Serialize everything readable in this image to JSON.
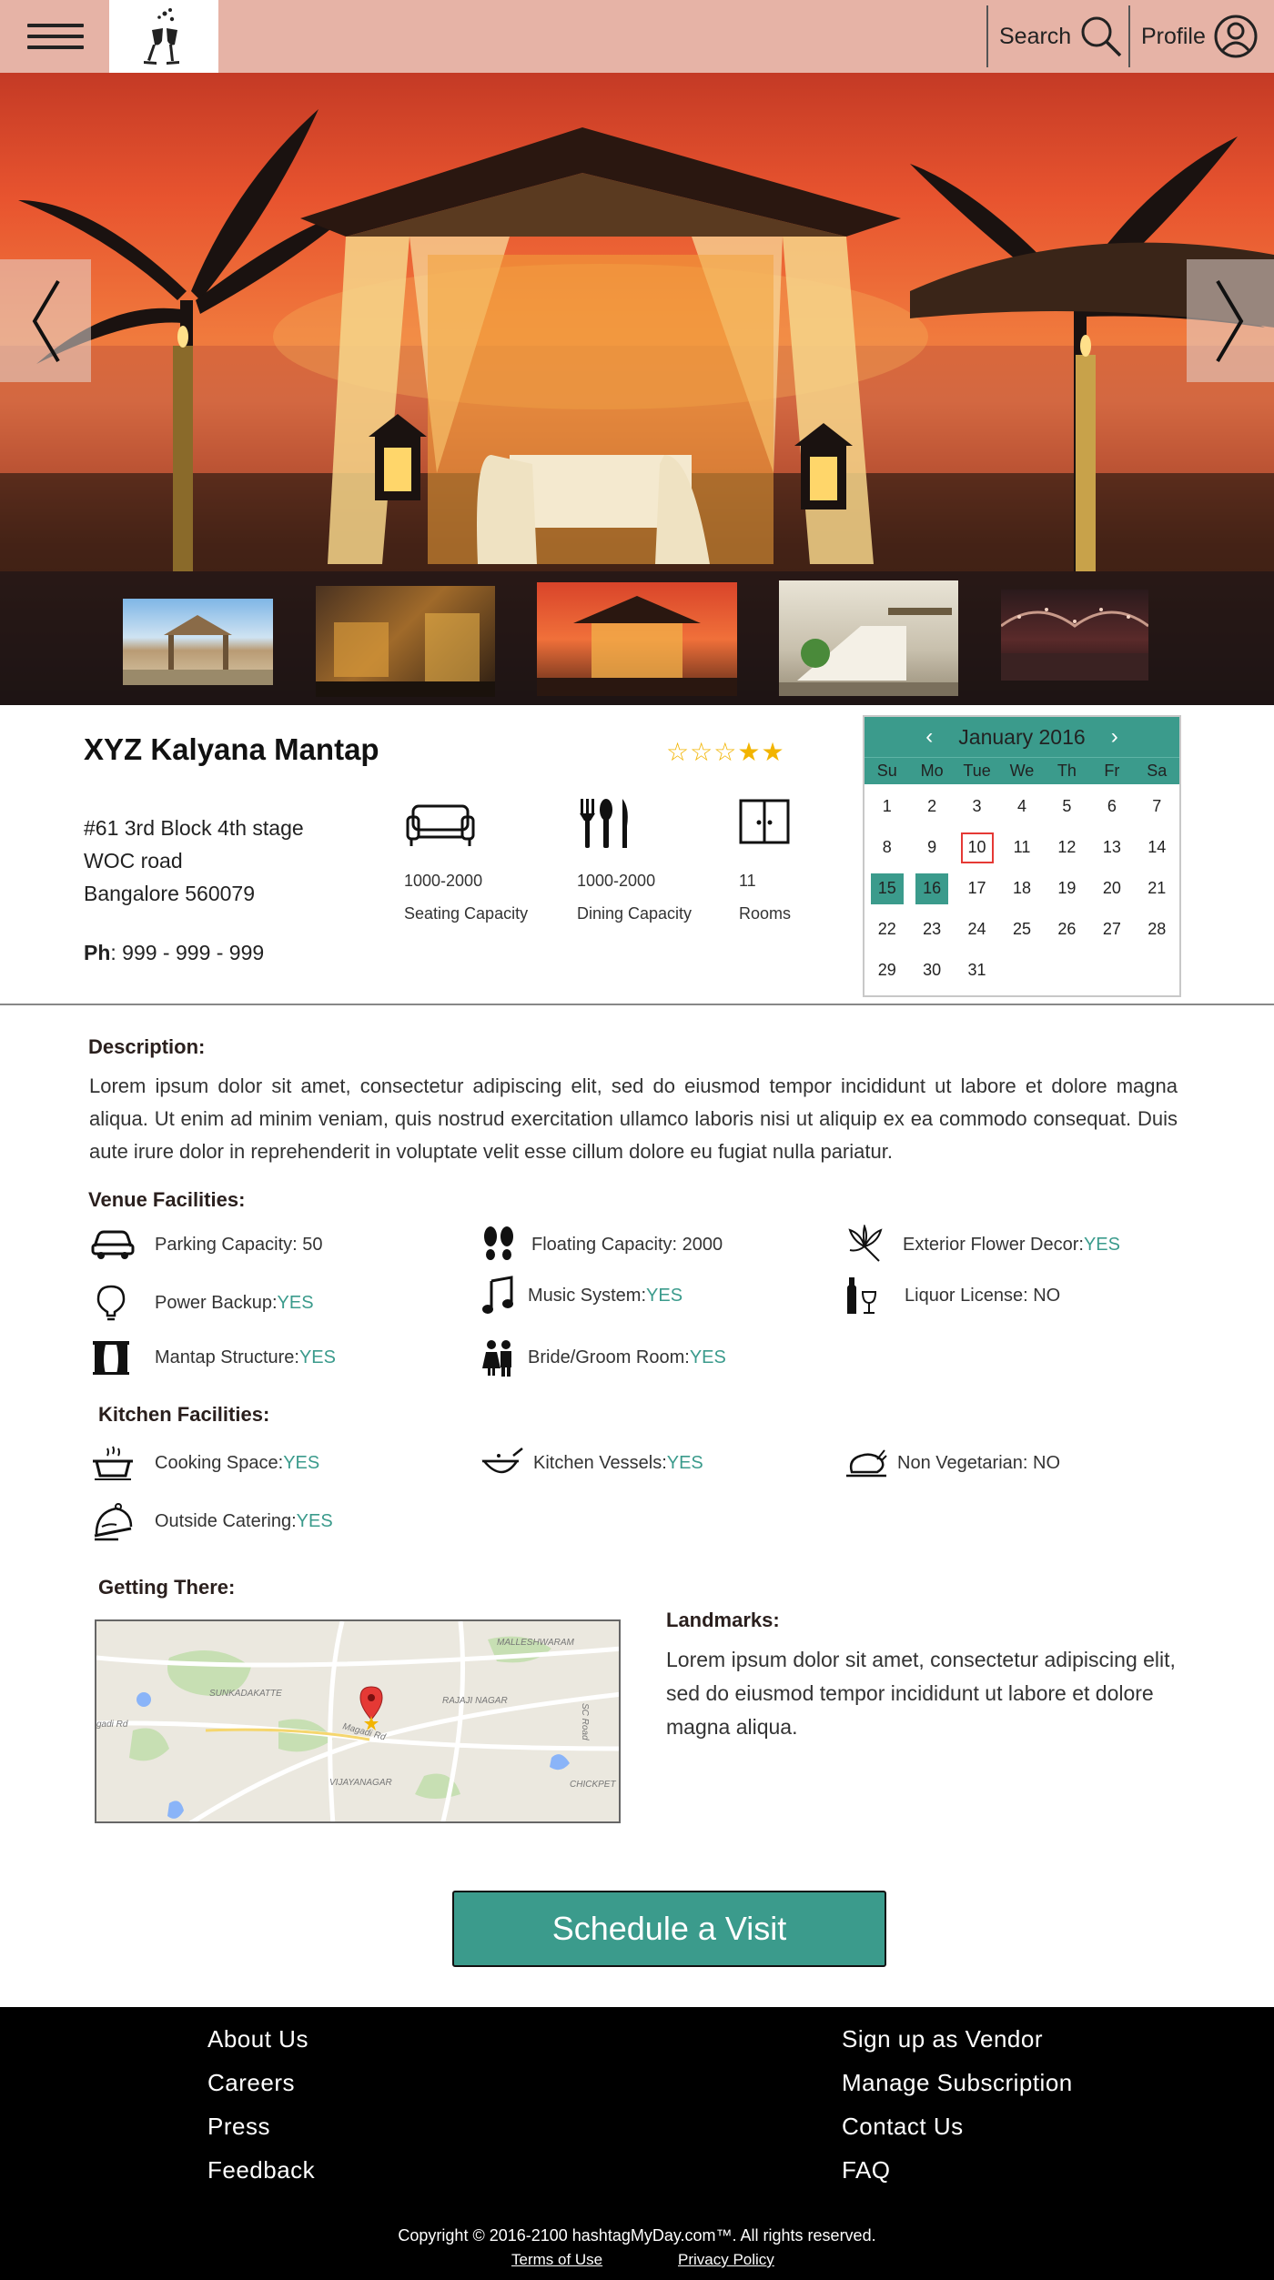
{
  "header": {
    "search_label": "Search",
    "profile_label": "Profile",
    "bg_color": "#e6b3a6",
    "icons": [
      "menu-icon",
      "champagne-glasses-logo",
      "search-icon",
      "profile-icon"
    ]
  },
  "hero": {
    "thumbnails": [
      "gazebo-day",
      "interior-bar",
      "gazebo-sunset",
      "hall-staircase",
      "ballroom-lights"
    ],
    "active_thumbnail": 3
  },
  "venue": {
    "name": "XYZ Kalyana Mantap",
    "rating": {
      "filled": 2,
      "total": 5
    },
    "address": [
      "#61 3rd Block 4th stage",
      "WOC road",
      "Bangalore 560079"
    ],
    "phone_label": "Ph",
    "phone": ": 999 - 999 - 999",
    "stats": [
      {
        "icon": "sofa-icon",
        "value": "1000-2000",
        "label": "Seating Capacity"
      },
      {
        "icon": "cutlery-icon",
        "value": "1000-2000",
        "label": "Dining Capacity"
      },
      {
        "icon": "door-icon",
        "value": "11",
        "label": "Rooms"
      }
    ]
  },
  "calendar": {
    "title": "January 2016",
    "prev": "‹",
    "next": "›",
    "weekdays": [
      "Su",
      "Mo",
      "Tue",
      "We",
      "Th",
      "Fr",
      "Sa"
    ],
    "days": [
      "1",
      "2",
      "3",
      "4",
      "5",
      "6",
      "7",
      "8",
      "9",
      "10",
      "11",
      "12",
      "13",
      "14",
      "15",
      "16",
      "17",
      "18",
      "19",
      "20",
      "21",
      "22",
      "23",
      "24",
      "25",
      "26",
      "27",
      "28",
      "29",
      "30",
      "31"
    ],
    "first_weekday": 0,
    "selected": [
      "15",
      "16"
    ],
    "today": "10",
    "accent": "#3b9b8c"
  },
  "description": {
    "title": "Description:",
    "text": "Lorem ipsum dolor sit amet, consectetur adipiscing elit, sed do eiusmod tempor incididunt ut labore et dolore magna aliqua. Ut enim ad minim veniam, quis nostrud exercitation ullamco laboris nisi ut aliquip ex ea commodo consequat. Duis aute irure dolor in reprehenderit in voluptate velit esse cillum dolore eu fugiat nulla pariatur."
  },
  "venue_facilities": {
    "title": "Venue Facilities:",
    "items": [
      {
        "icon": "car-icon",
        "label": "Parking Capacity: 50",
        "value": ""
      },
      {
        "icon": "footprints-icon",
        "label": "Floating Capacity: 2000",
        "value": ""
      },
      {
        "icon": "flower-icon",
        "label": "Exterior Flower Decor: ",
        "value": "YES"
      },
      {
        "icon": "bulb-icon",
        "label": "Power Backup: ",
        "value": "YES"
      },
      {
        "icon": "music-icon",
        "label": "Music System: ",
        "value": "YES"
      },
      {
        "icon": "wine-icon",
        "label": "Liquor License: NO",
        "value": ""
      },
      {
        "icon": "stage-curtain-icon",
        "label": "Mantap Structure: ",
        "value": "YES"
      },
      {
        "icon": "couple-icon",
        "label": "Bride/Groom Room: ",
        "value": "YES"
      }
    ]
  },
  "kitchen_facilities": {
    "title": "Kitchen Facilities:",
    "items": [
      {
        "icon": "pot-icon",
        "label": "Cooking Space: ",
        "value": "YES"
      },
      {
        "icon": "wok-icon",
        "label": "Kitchen Vessels: ",
        "value": "YES"
      },
      {
        "icon": "chicken-icon",
        "label": "Non Vegetarian: NO",
        "value": ""
      },
      {
        "icon": "cloche-icon",
        "label": "Outside Catering: ",
        "value": "YES"
      }
    ]
  },
  "getting_there": {
    "title": "Getting There:",
    "map_labels": [
      "MALLESHWARAM",
      "SUNKADAKATTE",
      "RAJAJI NAGAR",
      "Magadi Rd",
      "VIJAYANAGAR",
      "CHICKPET",
      "SC Road",
      "gadi Rd"
    ],
    "landmarks_title": "Landmarks:",
    "landmarks_text": "Lorem ipsum dolor sit amet, consectetur adipiscing elit, sed do eiusmod tempor incididunt ut labore et dolore magna aliqua."
  },
  "cta": {
    "schedule_label": "Schedule a Visit"
  },
  "footer": {
    "left_links": [
      "About Us",
      "Careers",
      "Press",
      "Feedback"
    ],
    "right_links": [
      "Sign up as Vendor",
      "Manage Subscription",
      "Contact Us",
      "FAQ"
    ],
    "copyright": "Copyright © 2016-2100 hashtagMyDay.com™. All rights reserved.",
    "terms": "Terms of Use",
    "privacy": "Privacy Policy"
  }
}
